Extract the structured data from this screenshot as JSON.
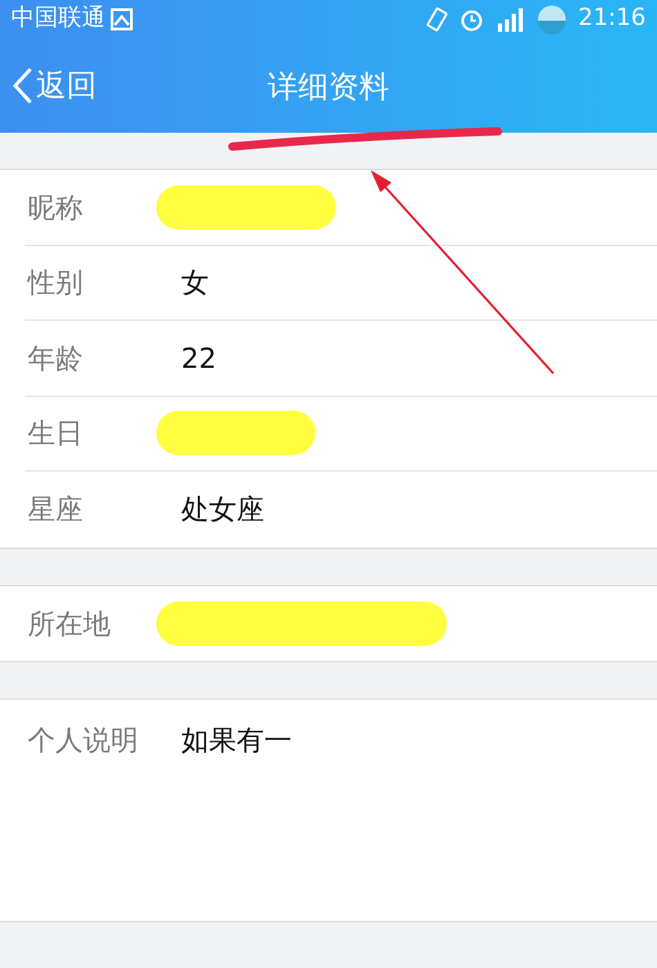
{
  "status_bar": {
    "carrier": "中国联通",
    "time": "21:16"
  },
  "header": {
    "back_label": "返回",
    "title": "详细资料"
  },
  "sections": [
    {
      "rows": [
        {
          "label": "昵称",
          "redacted": true
        },
        {
          "label": "性别",
          "value": "女",
          "redacted": false
        },
        {
          "label": "年龄",
          "value": "22",
          "redacted": false
        },
        {
          "label": "生日",
          "redacted": true
        },
        {
          "label": "星座",
          "value": "处女座",
          "redacted": false
        }
      ]
    },
    {
      "rows": [
        {
          "label": "所在地",
          "redacted": true
        }
      ]
    },
    {
      "tall": true,
      "rows": [
        {
          "label": "个人说明",
          "value": "如果有一",
          "redacted": false
        }
      ]
    }
  ],
  "annotations": {
    "title_underline": true,
    "pointer_arrow": true
  }
}
